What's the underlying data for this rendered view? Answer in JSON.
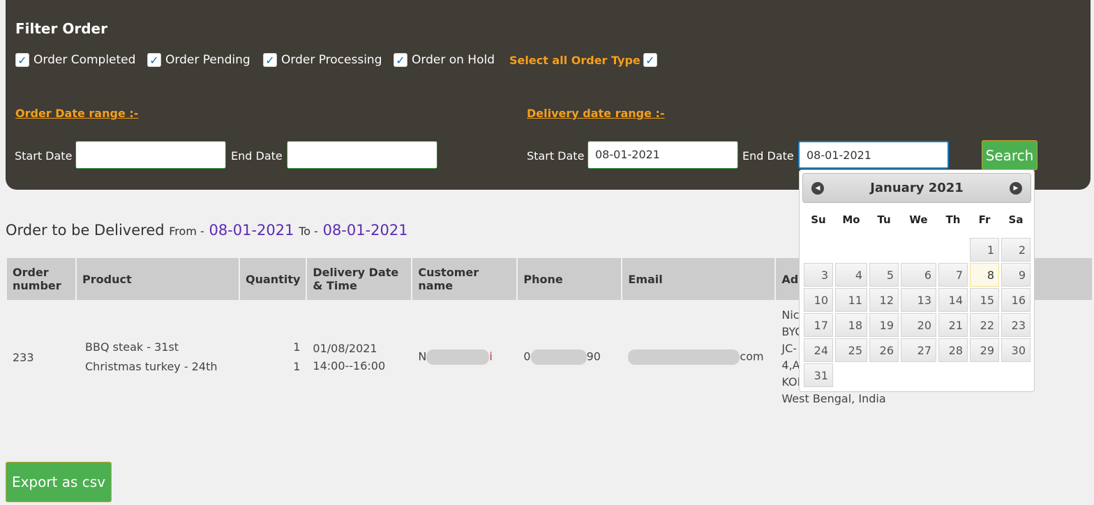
{
  "filter": {
    "title": "Filter Order",
    "checkboxes": [
      {
        "label": "Order Completed",
        "checked": true
      },
      {
        "label": "Order Pending",
        "checked": true
      },
      {
        "label": "Order Processing",
        "checked": true
      },
      {
        "label": "Order on Hold",
        "checked": true
      }
    ],
    "select_all": {
      "label": "Select all Order Type",
      "checked": true
    },
    "order_range": {
      "label": "Order Date range :-",
      "start_label": "Start Date :",
      "start_value": "",
      "end_label": "End Date :",
      "end_value": ""
    },
    "delivery_range": {
      "label": "Delivery date range :-",
      "start_label": "Start Date :",
      "start_value": "08-01-2021",
      "end_label": "End Date :",
      "end_value": "08-01-2021"
    },
    "search_label": "Search"
  },
  "heading": {
    "title": "Order to be Delivered",
    "from_label": "From -",
    "from": "08-01-2021",
    "to_label": "To -",
    "to": "08-01-2021"
  },
  "table": {
    "headers": [
      "Order number",
      "Product",
      "Quantity",
      "Delivery Date & Time",
      "Customer name",
      "Phone",
      "Email",
      "Address"
    ],
    "rows": [
      {
        "order": "233",
        "products": [
          "BBQ steak - 31st",
          "Christmas turkey - 24th"
        ],
        "quantities": [
          "1",
          "1"
        ],
        "date": "01/08/2021",
        "time": "14:00--16:00",
        "customer_prefix": "N",
        "customer_suffix": "i",
        "phone_prefix": "0",
        "phone_suffix": "90",
        "email_suffix": "com",
        "address": [
          "Nic",
          "BYC",
          "JC-",
          "4,A",
          "KOI",
          "West Bengal, India"
        ]
      }
    ]
  },
  "export_label": "Export as csv",
  "datepicker": {
    "month": "January 2021",
    "prev": "◀",
    "next": "▶",
    "weekdays": [
      "Su",
      "Mo",
      "Tu",
      "We",
      "Th",
      "Fr",
      "Sa"
    ],
    "first_weekday": 5,
    "days": 31,
    "highlighted": 8
  },
  "colors": {
    "panel": "#403c36",
    "accent": "#f5a01a",
    "button": "#4caf50",
    "date": "#5b2cb0"
  }
}
